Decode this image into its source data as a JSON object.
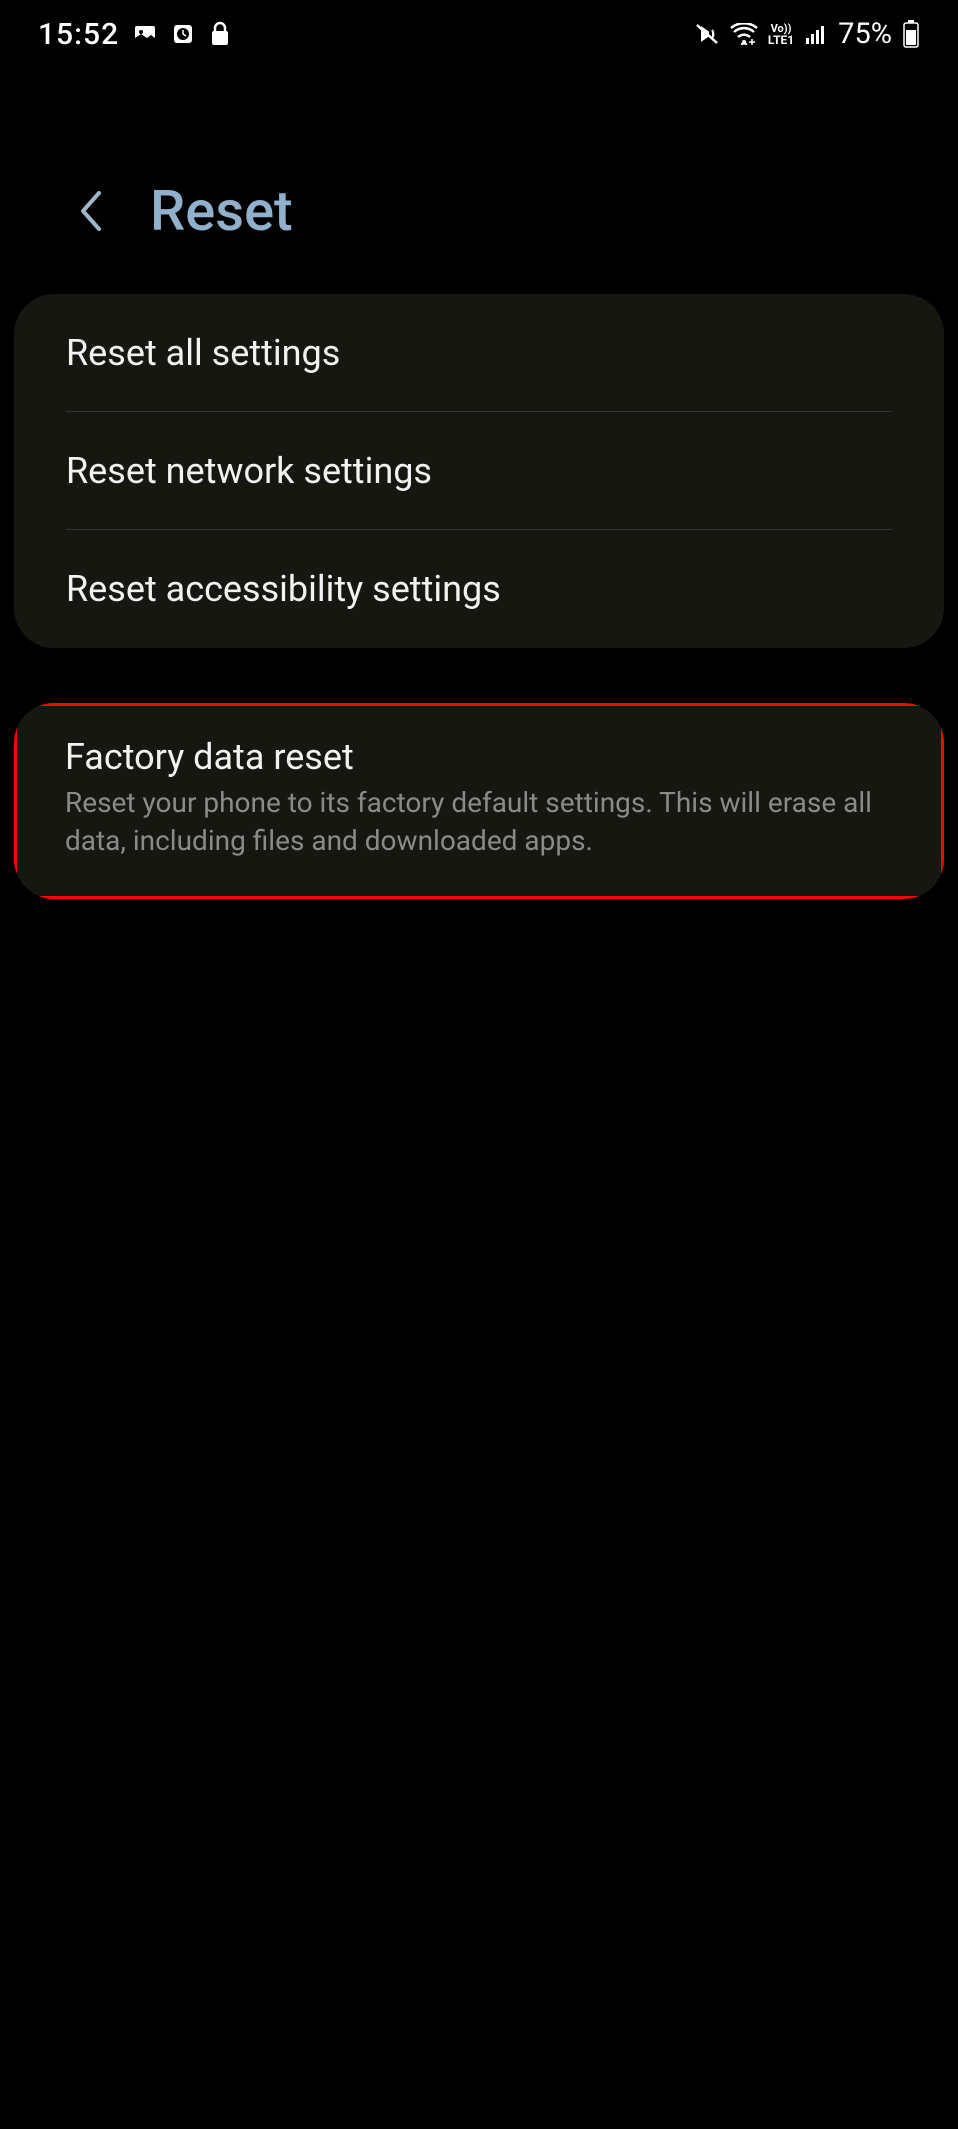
{
  "status": {
    "time": "15:52",
    "battery": "75%"
  },
  "header": {
    "title": "Reset"
  },
  "group1": {
    "items": [
      {
        "title": "Reset all settings"
      },
      {
        "title": "Reset network settings"
      },
      {
        "title": "Reset accessibility settings"
      }
    ]
  },
  "group2": {
    "items": [
      {
        "title": "Factory data reset",
        "desc": "Reset your phone to its factory default settings. This will erase all data, including files and downloaded apps."
      }
    ]
  }
}
